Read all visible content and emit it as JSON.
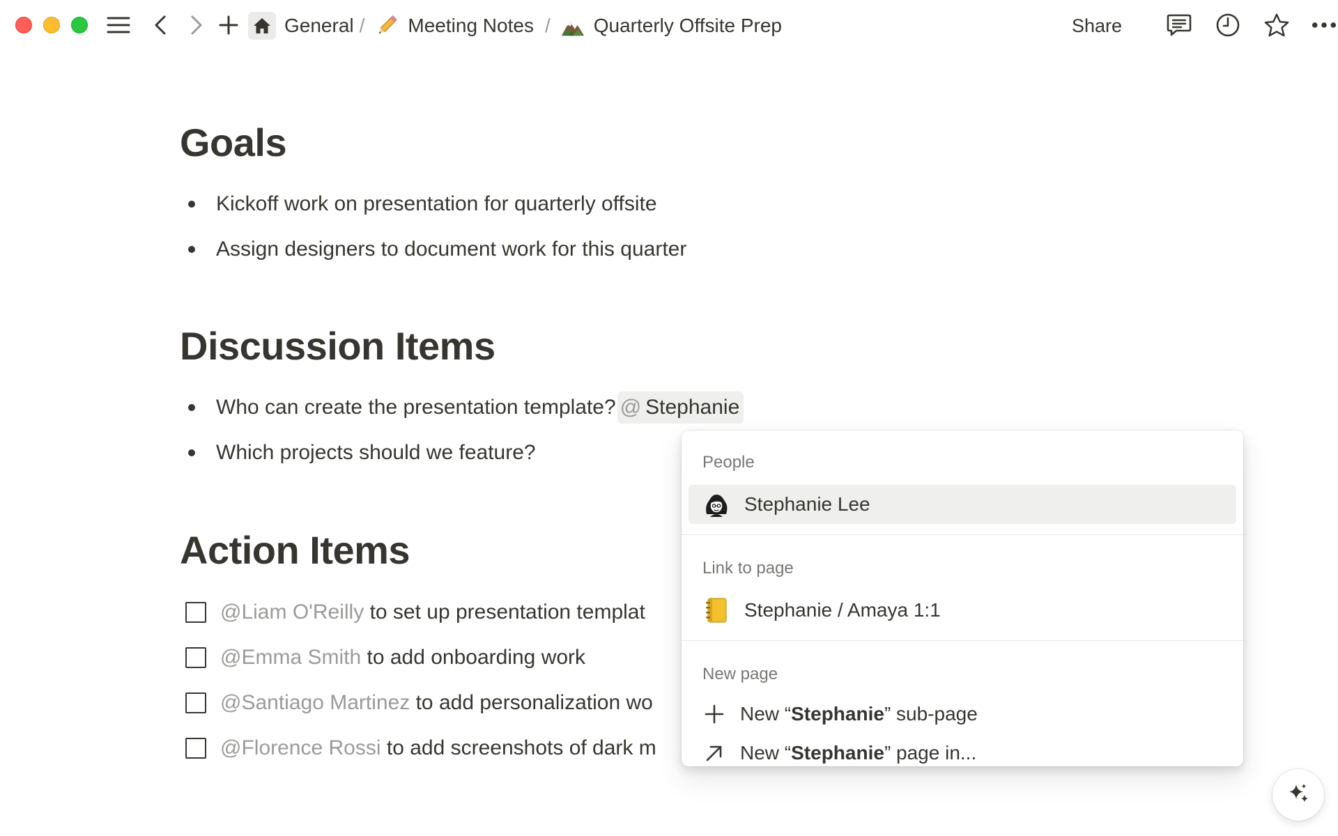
{
  "breadcrumb": {
    "workspace": "General",
    "sep1": "/",
    "parent": "Meeting Notes",
    "sep2": "/",
    "current": "Quarterly Offsite Prep"
  },
  "toolbar": {
    "share_label": "Share",
    "icons": [
      "sidebar-toggle-icon",
      "back-icon",
      "forward-icon",
      "new-page-icon",
      "home-icon",
      "comments-icon",
      "history-icon",
      "favorite-star-icon",
      "more-icon"
    ]
  },
  "sections": {
    "goals": {
      "title": "Goals",
      "items": [
        "Kickoff work on presentation for quarterly offsite",
        "Assign designers to document work for this quarter"
      ]
    },
    "discussion": {
      "title": "Discussion Items",
      "item1_text": "Who can create the presentation template?",
      "item1_mention_at": "@",
      "item1_mention_query": "Stephanie",
      "item2_text": "Which projects should we feature?"
    },
    "actions": {
      "title": "Action Items",
      "items": [
        {
          "mention": "@Liam O'Reilly",
          "text": " to set up presentation templat"
        },
        {
          "mention": "@Emma Smith",
          "text": " to add onboarding work"
        },
        {
          "mention": "@Santiago Martinez",
          "text": " to add personalization wo"
        },
        {
          "mention": "@Florence Rossi",
          "text": " to add screenshots of dark m"
        }
      ]
    }
  },
  "mention_menu": {
    "people_label": "People",
    "person_name": "Stephanie Lee",
    "link_label": "Link to page",
    "link_page": "Stephanie / Amaya 1:1",
    "new_page_label": "New page",
    "new_subpage": {
      "prefix": "New “",
      "query": "Stephanie",
      "suffix": "” sub-page"
    },
    "new_page_in": {
      "prefix": "New “",
      "query": "Stephanie",
      "suffix": "” page in..."
    }
  },
  "colors": {
    "text": "#37352f",
    "muted": "#9b9a97",
    "selected_bg": "#efefee",
    "traffic_red": "#ff5f57",
    "traffic_yellow": "#febc2e",
    "traffic_green": "#28c840"
  }
}
